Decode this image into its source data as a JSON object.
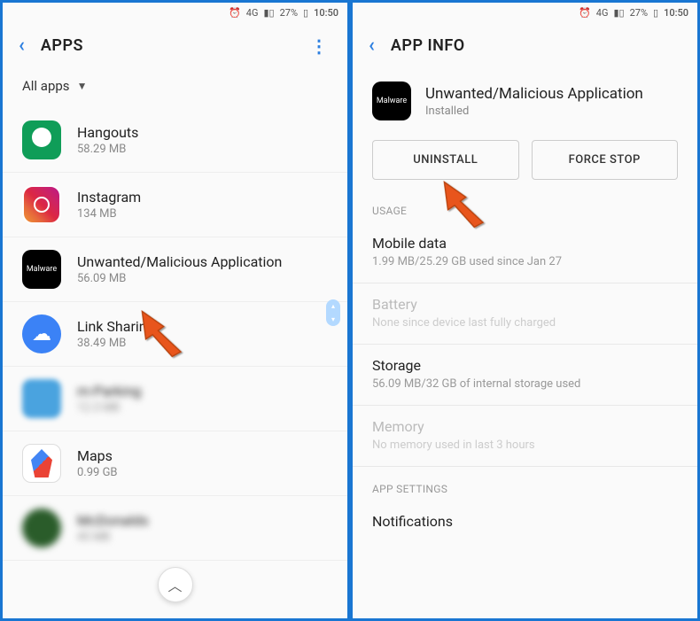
{
  "statusbar": {
    "network": "4G",
    "battery_percent": "27%",
    "time": "10:50"
  },
  "left": {
    "title": "APPS",
    "filter_label": "All apps",
    "apps": [
      {
        "name": "Hangouts",
        "size": "58.29 MB",
        "icon": "hangouts"
      },
      {
        "name": "Instagram",
        "size": "134 MB",
        "icon": "instagram"
      },
      {
        "name": "Unwanted/Malicious Application",
        "size": "56.09 MB",
        "icon": "malware",
        "icon_label": "Malware"
      },
      {
        "name": "Link Sharing",
        "size": "38.49 MB",
        "icon": "linkshare"
      },
      {
        "name": "m-Parking",
        "size": "12.3 MB",
        "icon": "blur1",
        "blurred": true
      },
      {
        "name": "Maps",
        "size": "0.99 GB",
        "icon": "maps"
      },
      {
        "name": "McDonalds",
        "size": "45 MB",
        "icon": "blur2",
        "blurred": true
      }
    ]
  },
  "right": {
    "title": "APP INFO",
    "app_name": "Unwanted/Malicious Application",
    "app_status": "Installed",
    "icon_label": "Malware",
    "buttons": {
      "uninstall": "UNINSTALL",
      "force_stop": "FORCE STOP"
    },
    "sections": {
      "usage_label": "USAGE",
      "mobile_data": {
        "title": "Mobile data",
        "sub": "1.99 MB/25.29 GB used since Jan 27"
      },
      "battery": {
        "title": "Battery",
        "sub": "None since device last fully charged"
      },
      "storage": {
        "title": "Storage",
        "sub": "56.09 MB/32 GB of internal storage used"
      },
      "memory": {
        "title": "Memory",
        "sub": "No memory used in last 3 hours"
      },
      "app_settings_label": "APP SETTINGS",
      "notifications": {
        "title": "Notifications"
      }
    }
  }
}
